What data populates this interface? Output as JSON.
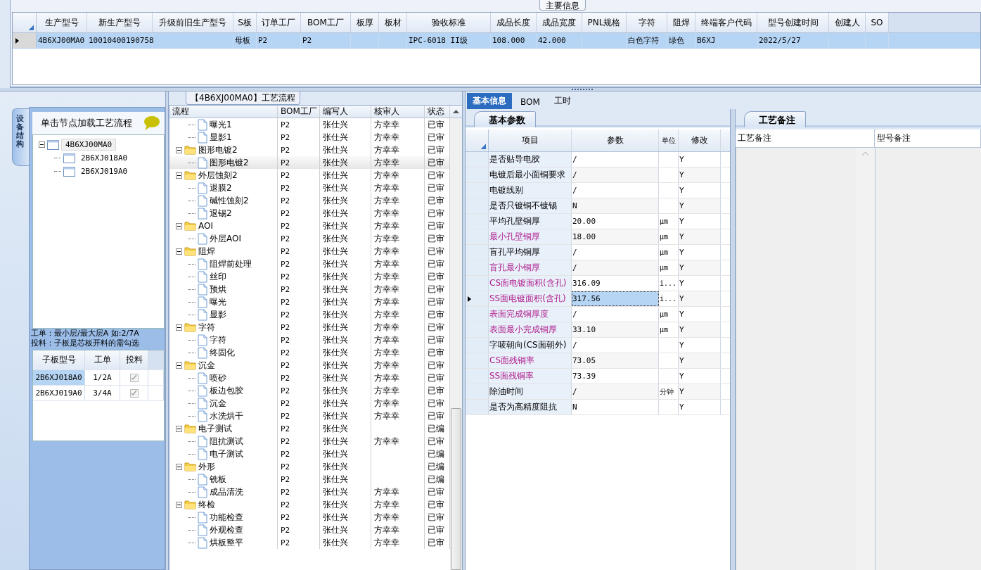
{
  "main_info": {
    "title": "主要信息",
    "columns": [
      "生产型号",
      "新生产型号",
      "升级前旧生产型号",
      "S板",
      "订单工厂",
      "BOM工厂",
      "板厚",
      "板材",
      "验收标准",
      "成品长度",
      "成品宽度",
      "PNL规格",
      "字符",
      "阻焊",
      "终端客户代码",
      "型号创建时间",
      "创建人",
      "SO"
    ],
    "rows": [
      {
        "selected": true,
        "cells": [
          "4B6XJ00MA0",
          "10010400190758",
          null,
          "母板",
          "P2",
          "P2",
          null,
          null,
          "IPC-6018 II级",
          "108.000",
          "42.000",
          null,
          "白色字符",
          "绿色",
          "B6XJ",
          "2022/5/27",
          null,
          null
        ]
      }
    ]
  },
  "structure_panel": {
    "tab_label": "设备结构",
    "hint": "单击节点加载工艺流程",
    "tree": [
      {
        "label": "4B6XJ00MA0",
        "expanded": true,
        "selected": true,
        "children": [
          {
            "label": "2B6XJ018A0",
            "selected": false
          },
          {
            "label": "2B6XJ019A0",
            "selected": false
          }
        ]
      }
    ],
    "notes": [
      "工单：最小层/最大层A 如:2/7A",
      "投料：子板是芯板开料的需勾选"
    ],
    "sub_boards": {
      "columns": [
        "子板型号",
        "工单",
        "投料"
      ],
      "rows": [
        {
          "model": "2B6XJ018A0",
          "order": "1/2A",
          "feed": true,
          "selected": true
        },
        {
          "model": "2B6XJ019A0",
          "order": "3/4A",
          "feed": true,
          "selected": false
        }
      ]
    }
  },
  "flow": {
    "title": "【4B6XJ00MA0】工艺流程",
    "columns": [
      "流程",
      "BOM工厂",
      "编写人",
      "核审人",
      "状态"
    ],
    "nodes": [
      {
        "children": [
          {
            "label": "曝光1",
            "bom": "P2",
            "writer": "张仕兴",
            "reviewer": "方幸幸",
            "status": "已审",
            "selected": false
          },
          {
            "label": "显影1",
            "bom": "P2",
            "writer": "张仕兴",
            "reviewer": "方幸幸",
            "status": "已审",
            "selected": false
          }
        ]
      },
      {
        "label": "图形电镀2",
        "bom": "P2",
        "writer": "张仕兴",
        "reviewer": "方幸幸",
        "status": "已审",
        "selected": false,
        "expanded": true,
        "children": [
          {
            "label": "图形电镀2",
            "bom": "P2",
            "writer": "张仕兴",
            "reviewer": "方幸幸",
            "status": "已审",
            "selected": true
          }
        ]
      },
      {
        "label": "外层蚀刻2",
        "bom": "P2",
        "writer": "张仕兴",
        "reviewer": "方幸幸",
        "status": "已审",
        "selected": false,
        "expanded": true,
        "children": [
          {
            "label": "退膜2",
            "bom": "P2",
            "writer": "张仕兴",
            "reviewer": "方幸幸",
            "status": "已审",
            "selected": false
          },
          {
            "label": "碱性蚀刻2",
            "bom": "P2",
            "writer": "张仕兴",
            "reviewer": "方幸幸",
            "status": "已审",
            "selected": false
          },
          {
            "label": "退锡2",
            "bom": "P2",
            "writer": "张仕兴",
            "reviewer": "方幸幸",
            "status": "已审",
            "selected": false
          }
        ]
      },
      {
        "label": "AOI",
        "bom": "P2",
        "writer": "张仕兴",
        "reviewer": "方幸幸",
        "status": "已审",
        "selected": false,
        "expanded": true,
        "children": [
          {
            "label": "外层AOI",
            "bom": "P2",
            "writer": "张仕兴",
            "reviewer": "方幸幸",
            "status": "已审",
            "selected": false
          }
        ]
      },
      {
        "label": "阻焊",
        "bom": "P2",
        "writer": "张仕兴",
        "reviewer": "方幸幸",
        "status": "已审",
        "selected": false,
        "expanded": true,
        "children": [
          {
            "label": "阻焊前处理",
            "bom": "P2",
            "writer": "张仕兴",
            "reviewer": "方幸幸",
            "status": "已审",
            "selected": false
          },
          {
            "label": "丝印",
            "bom": "P2",
            "writer": "张仕兴",
            "reviewer": "方幸幸",
            "status": "已审",
            "selected": false
          },
          {
            "label": "预烘",
            "bom": "P2",
            "writer": "张仕兴",
            "reviewer": "方幸幸",
            "status": "已审",
            "selected": false
          },
          {
            "label": "曝光",
            "bom": "P2",
            "writer": "张仕兴",
            "reviewer": "方幸幸",
            "status": "已审",
            "selected": false
          },
          {
            "label": "显影",
            "bom": "P2",
            "writer": "张仕兴",
            "reviewer": "方幸幸",
            "status": "已审",
            "selected": false
          }
        ]
      },
      {
        "label": "字符",
        "bom": "P2",
        "writer": "张仕兴",
        "reviewer": "方幸幸",
        "status": "已审",
        "selected": false,
        "expanded": true,
        "children": [
          {
            "label": "字符",
            "bom": "P2",
            "writer": "张仕兴",
            "reviewer": "方幸幸",
            "status": "已审",
            "selected": false
          },
          {
            "label": "终固化",
            "bom": "P2",
            "writer": "张仕兴",
            "reviewer": "方幸幸",
            "status": "已审",
            "selected": false
          }
        ]
      },
      {
        "label": "沉金",
        "bom": "P2",
        "writer": "张仕兴",
        "reviewer": "方幸幸",
        "status": "已审",
        "selected": false,
        "expanded": true,
        "children": [
          {
            "label": "喷砂",
            "bom": "P2",
            "writer": "张仕兴",
            "reviewer": "方幸幸",
            "status": "已审",
            "selected": false
          },
          {
            "label": "板边包胶",
            "bom": "P2",
            "writer": "张仕兴",
            "reviewer": "方幸幸",
            "status": "已审",
            "selected": false
          },
          {
            "label": "沉金",
            "bom": "P2",
            "writer": "张仕兴",
            "reviewer": "方幸幸",
            "status": "已审",
            "selected": false
          },
          {
            "label": "水洗烘干",
            "bom": "P2",
            "writer": "张仕兴",
            "reviewer": "方幸幸",
            "status": "已审",
            "selected": false
          }
        ]
      },
      {
        "label": "电子测试",
        "bom": "P2",
        "writer": "张仕兴",
        "status": "已编",
        "selected": false,
        "expanded": true,
        "children": [
          {
            "label": "阻抗测试",
            "bom": "P2",
            "writer": "张仕兴",
            "reviewer": "方幸幸",
            "status": "已审",
            "selected": false
          },
          {
            "label": "电子测试",
            "bom": "P2",
            "writer": "张仕兴",
            "status": "已编",
            "selected": false
          }
        ]
      },
      {
        "label": "外形",
        "bom": "P2",
        "writer": "张仕兴",
        "status": "已编",
        "selected": false,
        "expanded": true,
        "children": [
          {
            "label": "铣板",
            "bom": "P2",
            "writer": "张仕兴",
            "status": "已编",
            "selected": false
          },
          {
            "label": "成品清洗",
            "bom": "P2",
            "writer": "张仕兴",
            "reviewer": "方幸幸",
            "status": "已审",
            "selected": false
          }
        ]
      },
      {
        "label": "终检",
        "bom": "P2",
        "writer": "张仕兴",
        "reviewer": "方幸幸",
        "status": "已审",
        "selected": false,
        "expanded": true,
        "children": [
          {
            "label": "功能检查",
            "bom": "P2",
            "writer": "张仕兴",
            "reviewer": "方幸幸",
            "status": "已审",
            "selected": false
          },
          {
            "label": "外观检查",
            "bom": "P2",
            "writer": "张仕兴",
            "reviewer": "方幸幸",
            "status": "已审",
            "selected": false
          },
          {
            "label": "烘板整平",
            "bom": "P2",
            "writer": "张仕兴",
            "reviewer": "方幸幸",
            "status": "已审",
            "selected": false
          }
        ]
      }
    ]
  },
  "detail_tabs": [
    {
      "label": "基本信息",
      "selected": true
    },
    {
      "label": "BOM",
      "selected": false
    },
    {
      "label": "工时",
      "selected": false
    }
  ],
  "params": {
    "tab_label": "基本参数",
    "columns": [
      "项目",
      "参数",
      "单位",
      "修改"
    ],
    "rows": [
      {
        "name": "是否贴导电胶",
        "value": "/",
        "modify": "Y",
        "highlighted": false,
        "selected": false
      },
      {
        "name": "电镀后最小面铜要求",
        "value": "/",
        "modify": "Y",
        "highlighted": false,
        "selected": false
      },
      {
        "name": "电镀线别",
        "value": "/",
        "modify": "Y",
        "highlighted": false,
        "selected": false
      },
      {
        "name": "是否只镀铜不镀锡",
        "value": "N",
        "modify": "Y",
        "highlighted": false,
        "selected": false
      },
      {
        "name": "平均孔壁铜厚",
        "value": "20.00",
        "unit": "μm",
        "modify": "Y",
        "highlighted": false,
        "selected": false
      },
      {
        "name": "最小孔壁铜厚",
        "value": "18.00",
        "unit": "μm",
        "modify": "Y",
        "highlighted": true,
        "selected": false
      },
      {
        "name": "盲孔平均铜厚",
        "value": "/",
        "unit": "μm",
        "modify": "Y",
        "highlighted": false,
        "selected": false
      },
      {
        "name": "盲孔最小铜厚",
        "value": "/",
        "unit": "μm",
        "modify": "Y",
        "highlighted": true,
        "selected": false
      },
      {
        "name": "CS面电镀面积(含孔)",
        "value": "316.09",
        "unit": "i...",
        "modify": "Y",
        "highlighted": true,
        "selected": false
      },
      {
        "name": "SS面电镀面积(含孔)",
        "value": "317.56",
        "unit": "i...",
        "modify": "Y",
        "highlighted": true,
        "selected": true
      },
      {
        "name": "表面完成铜厚度",
        "value": "/",
        "unit": "μm",
        "modify": "Y",
        "highlighted": true,
        "selected": false
      },
      {
        "name": "表面最小完成铜厚",
        "value": "33.10",
        "unit": "μm",
        "modify": "Y",
        "highlighted": true,
        "selected": false
      },
      {
        "name": "字唛朝向(CS面朝外)",
        "value": "/",
        "modify": "Y",
        "highlighted": false,
        "selected": false
      },
      {
        "name": "CS面残铜率",
        "value": "73.05",
        "modify": "Y",
        "highlighted": true,
        "selected": false
      },
      {
        "name": "SS面残铜率",
        "value": "73.39",
        "modify": "Y",
        "highlighted": true,
        "selected": false
      },
      {
        "name": "除油时间",
        "value": "/",
        "unit": "分钟",
        "modify": "Y",
        "highlighted": false,
        "selected": false
      },
      {
        "name": "是否为高精度阻抗",
        "value": "N",
        "modify": "Y",
        "highlighted": false,
        "selected": false
      }
    ]
  },
  "notes_panel": {
    "tab_label": "工艺备注",
    "columns": [
      "工艺备注",
      "型号备注"
    ]
  }
}
